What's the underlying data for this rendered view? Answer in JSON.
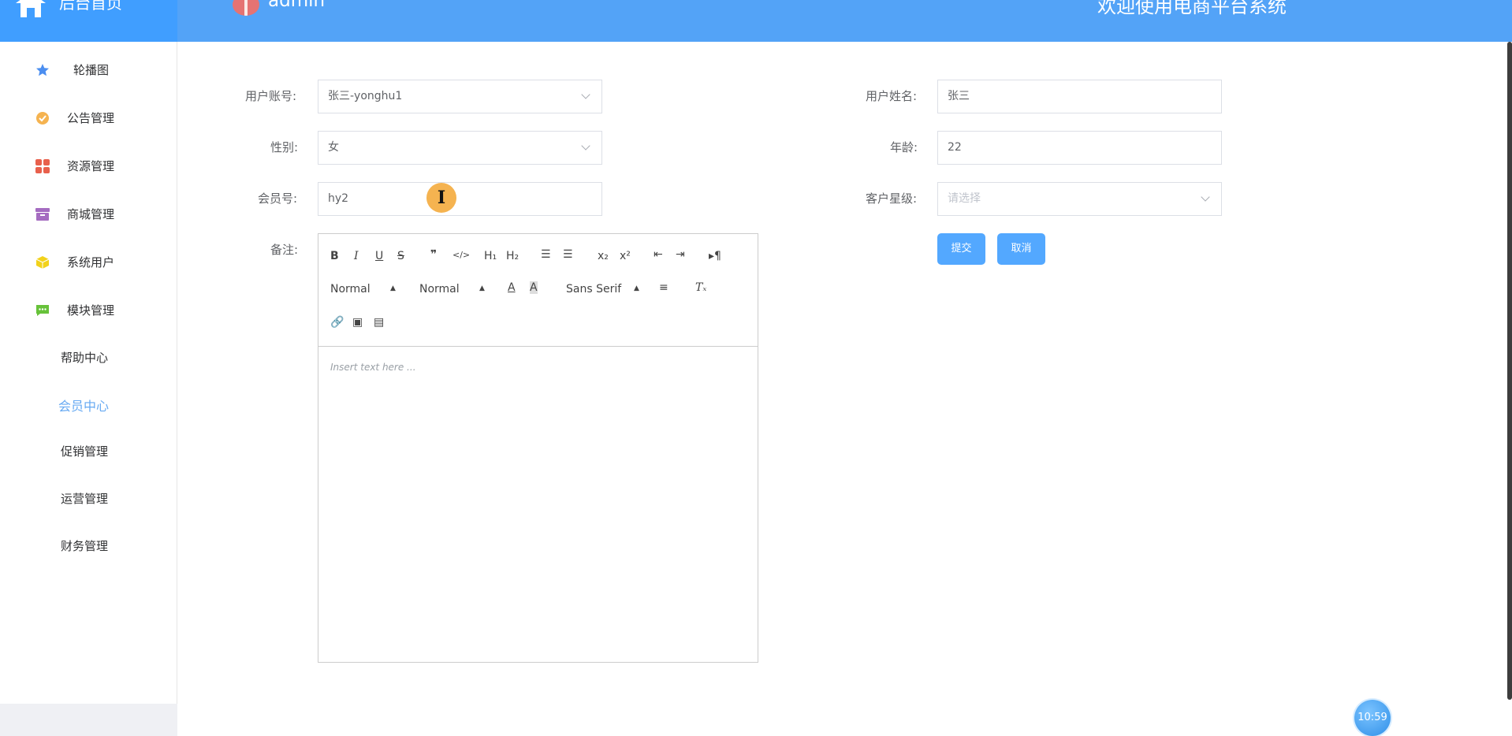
{
  "header": {
    "brand": "后台首页",
    "user_name": "admin",
    "welcome": "欢迎使用电商平台系统"
  },
  "sidebar": {
    "items": [
      {
        "label": "轮播图",
        "icon": "star-icon",
        "color": "#4b8ef0"
      },
      {
        "label": "公告管理",
        "icon": "badge-icon",
        "color": "#f5b350"
      },
      {
        "label": "资源管理",
        "icon": "grid-icon",
        "color": "#e8604c"
      },
      {
        "label": "商城管理",
        "icon": "archive-icon",
        "color": "#a56cc1"
      },
      {
        "label": "系统用户",
        "icon": "cube-icon",
        "color": "#f2d21b"
      },
      {
        "label": "模块管理",
        "icon": "chat-icon",
        "color": "#67c23a"
      }
    ],
    "sub_items": [
      {
        "label": "帮助中心",
        "active": false
      },
      {
        "label": "会员中心",
        "active": true
      },
      {
        "label": "促销管理",
        "active": false
      },
      {
        "label": "运营管理",
        "active": false
      },
      {
        "label": "财务管理",
        "active": false
      }
    ]
  },
  "form": {
    "account_label": "用户账号:",
    "account_value": "张三-yonghu1",
    "gender_label": "性别:",
    "gender_value": "女",
    "member_label": "会员号:",
    "member_value": "hy2",
    "remark_label": "备注:",
    "name_label": "用户姓名:",
    "name_value": "张三",
    "age_label": "年龄:",
    "age_value": "22",
    "level_label": "客户星级:",
    "level_placeholder": "请选择",
    "submit": "提交",
    "cancel": "取消"
  },
  "editor": {
    "header_picker": "Normal",
    "size_picker": "Normal",
    "font_picker": "Sans Serif",
    "placeholder": "Insert text here ..."
  },
  "clock": "10:59"
}
